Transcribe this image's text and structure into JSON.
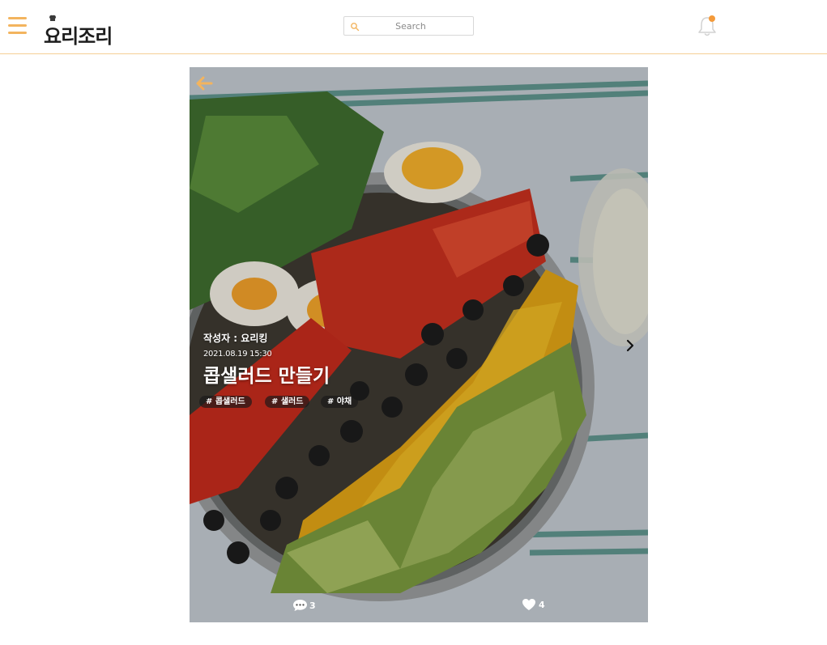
{
  "app": {
    "logo_text": "요리조리",
    "accent_color": "#f3b45e",
    "notification_dot_color": "#f49a3a"
  },
  "header": {
    "menu_icon": "hamburger-icon",
    "search": {
      "placeholder": "Search",
      "value": "",
      "icon": "search-icon"
    },
    "notification_icon": "bell-icon"
  },
  "recipe": {
    "author": "작성자 : 요리킹",
    "date": "2021.08.19 15:30",
    "title": "콥샐러드 만들기",
    "tags": [
      "# 콥샐러드",
      "# 샐러드",
      "# 야채"
    ],
    "comments": "3",
    "likes": "4",
    "icons": {
      "back": "back-arrow-icon",
      "next": "chevron-right-icon",
      "comment": "speech-bubble-icon",
      "like": "heart-icon"
    }
  }
}
